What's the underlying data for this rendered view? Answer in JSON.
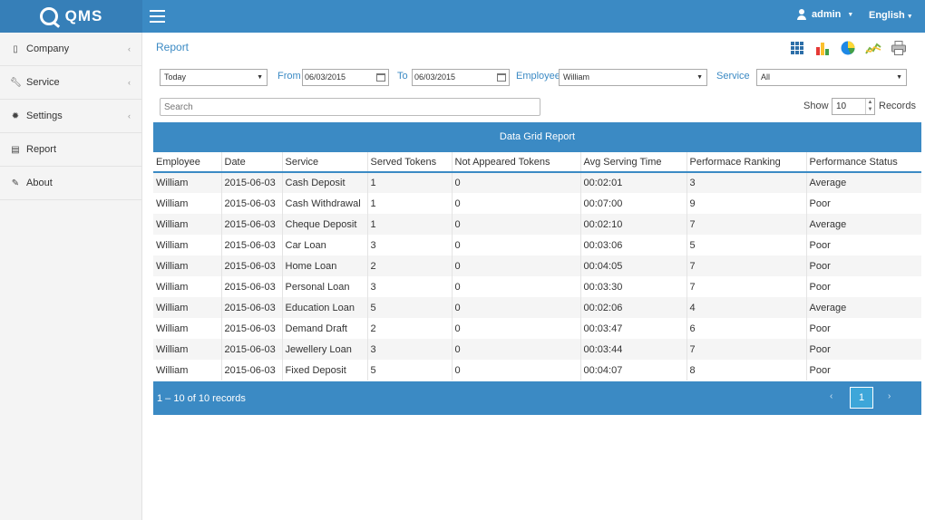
{
  "app": {
    "logo_text": "QMS"
  },
  "header": {
    "user_label": "admin",
    "language_label": "English"
  },
  "sidebar": {
    "items": [
      {
        "label": "Company",
        "icon": "building-icon"
      },
      {
        "label": "Service",
        "icon": "wrench-icon"
      },
      {
        "label": "Settings",
        "icon": "gear-icon"
      },
      {
        "label": "Report",
        "icon": "report-icon"
      },
      {
        "label": "About",
        "icon": "edit-icon"
      }
    ]
  },
  "breadcrumb": "Report",
  "toolbar": {
    "icons": [
      "grid-view-icon",
      "bar-chart-icon",
      "pie-chart-icon",
      "line-chart-icon",
      "print-icon"
    ]
  },
  "filters": {
    "period": "Today",
    "from_label": "From",
    "from_date": "06/03/2015",
    "to_label": "To",
    "to_date": "06/03/2015",
    "employee_label": "Employee",
    "employee_value": "William",
    "service_label": "Service",
    "service_value": "All"
  },
  "search": {
    "placeholder": "Search"
  },
  "paging": {
    "show_label": "Show",
    "page_size": "10",
    "records_label": "Records"
  },
  "grid": {
    "title": "Data Grid Report",
    "columns": [
      "Employee",
      "Date",
      "Service",
      "Served Tokens",
      "Not Appeared Tokens",
      "Avg Serving Time",
      "Performace Ranking",
      "Performance Status"
    ],
    "rows": [
      [
        "William",
        "2015-06-03",
        "Cash Deposit",
        "1",
        "0",
        "00:02:01",
        "3",
        "Average"
      ],
      [
        "William",
        "2015-06-03",
        "Cash Withdrawal",
        "1",
        "0",
        "00:07:00",
        "9",
        "Poor"
      ],
      [
        "William",
        "2015-06-03",
        "Cheque Deposit",
        "1",
        "0",
        "00:02:10",
        "7",
        "Average"
      ],
      [
        "William",
        "2015-06-03",
        "Car Loan",
        "3",
        "0",
        "00:03:06",
        "5",
        "Poor"
      ],
      [
        "William",
        "2015-06-03",
        "Home Loan",
        "2",
        "0",
        "00:04:05",
        "7",
        "Poor"
      ],
      [
        "William",
        "2015-06-03",
        "Personal Loan",
        "3",
        "0",
        "00:03:30",
        "7",
        "Poor"
      ],
      [
        "William",
        "2015-06-03",
        "Education Loan",
        "5",
        "0",
        "00:02:06",
        "4",
        "Average"
      ],
      [
        "William",
        "2015-06-03",
        "Demand Draft",
        "2",
        "0",
        "00:03:47",
        "6",
        "Poor"
      ],
      [
        "William",
        "2015-06-03",
        "Jewellery Loan",
        "3",
        "0",
        "00:03:44",
        "7",
        "Poor"
      ],
      [
        "William",
        "2015-06-03",
        "Fixed Deposit",
        "5",
        "0",
        "00:04:07",
        "8",
        "Poor"
      ]
    ],
    "footer_info": "1 – 10 of 10 records",
    "current_page": "1"
  },
  "colors": {
    "primary": "#3b8ac4",
    "active_page": "#3da6d9"
  }
}
